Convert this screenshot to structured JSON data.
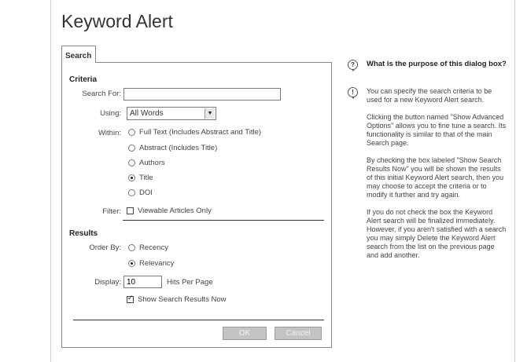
{
  "dialog": {
    "title": "Keyword Alert",
    "tab_label": "Search"
  },
  "criteria": {
    "heading": "Criteria",
    "search_for_label": "Search For:",
    "search_for_value": "",
    "using_label": "Using:",
    "using_selected": "All Words",
    "within_label": "Within:",
    "within_options": [
      {
        "label": "Full Text (Includes Abstract and Title)",
        "checked": false
      },
      {
        "label": "Abstract (Includes Title)",
        "checked": false
      },
      {
        "label": "Authors",
        "checked": false
      },
      {
        "label": "Title",
        "checked": true
      },
      {
        "label": "DOI",
        "checked": false
      }
    ],
    "filter_label": "Filter:",
    "filter_option": "Viewable Articles Only",
    "filter_checked": false
  },
  "results": {
    "heading": "Results",
    "order_by_label": "Order By:",
    "order_options": [
      {
        "label": "Recency",
        "checked": false
      },
      {
        "label": "Relevancy",
        "checked": true
      }
    ],
    "display_label": "Display:",
    "display_value": "10",
    "hits_per_page_label": "Hits Per Page",
    "show_results_label": "Show Search Results Now",
    "show_results_checked": true
  },
  "buttons": {
    "ok": "OK",
    "cancel": "Cancel"
  },
  "help": {
    "question": "What is the purpose of this dialog box?",
    "paragraphs": [
      "You can specify the search criteria to be used for a new Keyword Alert search.",
      "Clicking the button named \"Show Advanced Options\" allows you to fine tune a search. Its functionality is similar to that of the main Search page.",
      "By checking the box labeled \"Show Search Results Now\" you will be shown the results of this initial Keyword Alert search, then you may choose to accept the criteria or to modify it further and try again.",
      "If you do not check the box the Keyword Alert search will be finalized immediately. However, if you aren't satisfied with a search you may simply Delete the Keyword Alert search from the list on the previous page and add another."
    ]
  }
}
